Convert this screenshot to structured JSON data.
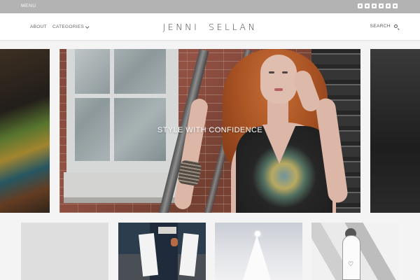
{
  "topbar": {
    "menu_label": "MENU",
    "socials": [
      "facebook-icon",
      "twitter-icon",
      "google-plus-icon",
      "linkedin-icon",
      "instagram-icon",
      "pinterest-icon"
    ]
  },
  "header": {
    "nav": {
      "about": "ABOUT",
      "categories": "CATEGORIES"
    },
    "logo": "JENNI SELLAN",
    "search_label": "SEARCH"
  },
  "slider": {
    "current_title": "STYLE WITH CONFIDENCE"
  },
  "colors": {
    "topbar_bg": "#b3b3b3",
    "header_bg": "#ffffff",
    "page_bg": "#f4f4f4"
  },
  "thumbnails": [
    "",
    "",
    "",
    "♡"
  ]
}
